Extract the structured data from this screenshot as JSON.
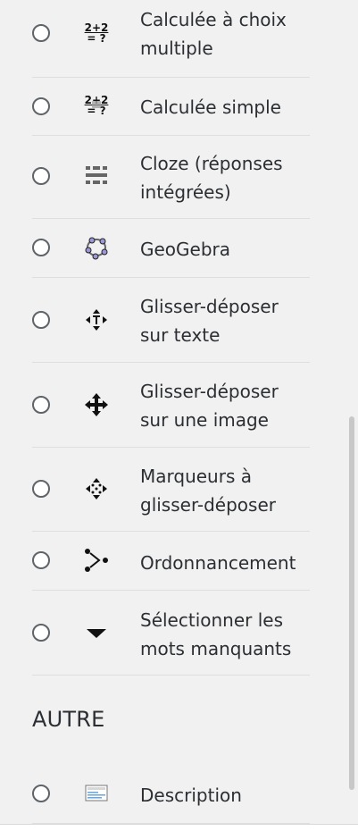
{
  "items": [
    {
      "label": "Calculée à choix multiple",
      "icon": "calculated-multichoice-icon",
      "icon_text_top": "2+2",
      "icon_text_bottom": "= ?"
    },
    {
      "label": "Calculée simple",
      "icon": "calculated-simple-icon",
      "icon_text_top": "2+2",
      "icon_text_bottom": "= ?"
    },
    {
      "label": "Cloze (réponses intégrées)",
      "icon": "cloze-icon"
    },
    {
      "label": "GeoGebra",
      "icon": "geogebra-icon"
    },
    {
      "label": "Glisser-déposer sur texte",
      "icon": "drag-drop-text-icon"
    },
    {
      "label": "Glisser-déposer sur une image",
      "icon": "drag-drop-image-icon"
    },
    {
      "label": "Marqueurs à glisser-déposer",
      "icon": "drag-drop-markers-icon"
    },
    {
      "label": "Ordonnancement",
      "icon": "ordering-icon"
    },
    {
      "label": "Sélectionner les mots manquants",
      "icon": "select-missing-words-icon"
    }
  ],
  "section_other": "AUTRE",
  "description": {
    "label": "Description",
    "icon": "description-icon"
  }
}
